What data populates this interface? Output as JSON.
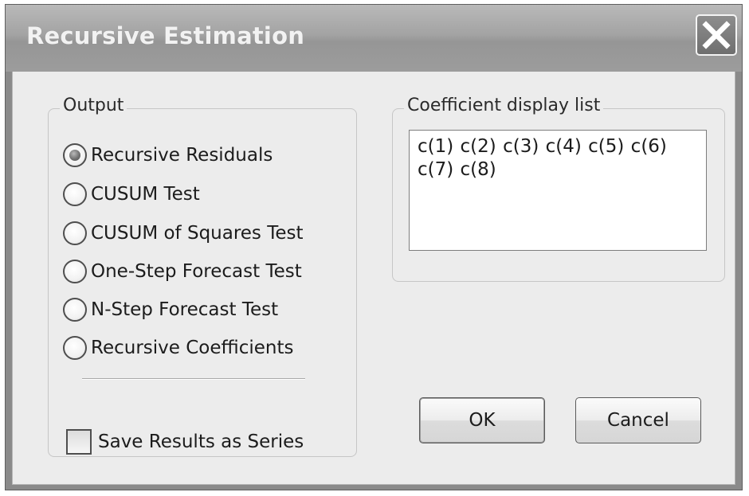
{
  "dialog": {
    "title": "Recursive Estimation"
  },
  "output_group": {
    "legend": "Output",
    "options": [
      {
        "label": "Recursive Residuals",
        "selected": true
      },
      {
        "label": "CUSUM Test",
        "selected": false
      },
      {
        "label": "CUSUM of Squares Test",
        "selected": false
      },
      {
        "label": "One-Step Forecast Test",
        "selected": false
      },
      {
        "label": "N-Step Forecast Test",
        "selected": false
      },
      {
        "label": "Recursive Coefficients",
        "selected": false
      }
    ],
    "save_results": {
      "label": "Save Results as Series",
      "checked": false
    }
  },
  "coefficient_group": {
    "legend": "Coefficient display list",
    "value": "c(1) c(2) c(3) c(4) c(5) c(6) c(7) c(8)"
  },
  "buttons": {
    "ok": "OK",
    "cancel": "Cancel"
  },
  "icons": {
    "close": "close-icon",
    "radio": "radio-button",
    "checkbox": "checkbox"
  }
}
